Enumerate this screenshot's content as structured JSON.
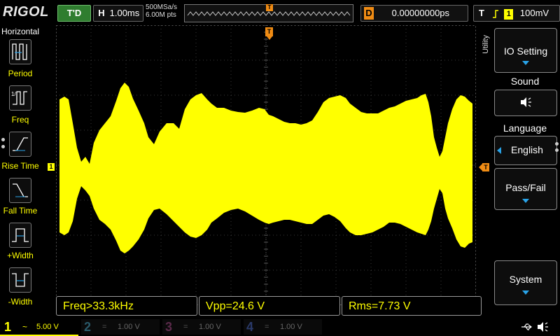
{
  "brand": "RIGOL",
  "top": {
    "trigger_status": "T'D",
    "horizontal_label": "H",
    "timebase": "1.00ms",
    "sample_rate": "500MSa/s",
    "memory_depth": "6.00M pts",
    "delay_label": "D",
    "delay_value": "0.00000000ps",
    "trigger_label": "T",
    "trigger_edge_icon": "rising-edge-icon",
    "trigger_channel": "1",
    "trigger_level": "100mV",
    "marker_label": "T"
  },
  "left_menu": {
    "title": "Horizontal",
    "items": [
      {
        "label": "Period",
        "icon": "period-icon"
      },
      {
        "label": "Freq",
        "icon": "frequency-icon"
      },
      {
        "label": "Rise Time",
        "icon": "rise-time-icon"
      },
      {
        "label": "Fall Time",
        "icon": "fall-time-icon"
      },
      {
        "label": "+Width",
        "icon": "positive-width-icon"
      },
      {
        "label": "-Width",
        "icon": "negative-width-icon"
      }
    ]
  },
  "right_menu": {
    "header": "Utility",
    "items": [
      {
        "label": "IO Setting"
      },
      {
        "label": "Sound",
        "value_icon": "speaker-icon"
      },
      {
        "label": "Language",
        "value": "English"
      },
      {
        "label": "Pass/Fail"
      },
      {
        "label": "System"
      }
    ]
  },
  "measurements": [
    "Freq>33.3kHz",
    "Vpp=24.6 V",
    "Rms=7.73 V"
  ],
  "channels": [
    {
      "num": "1",
      "scale": "5.00 V",
      "coupling": "~",
      "color": "#ffff00",
      "active": true
    },
    {
      "num": "2",
      "scale": "1.00 V",
      "coupling": "=",
      "color": "#2aa9d9",
      "active": false
    },
    {
      "num": "3",
      "scale": "1.00 V",
      "coupling": "=",
      "color": "#d14fa0",
      "active": false
    },
    {
      "num": "4",
      "scale": "1.00 V",
      "coupling": "=",
      "color": "#2a6bd9",
      "active": false
    }
  ],
  "channel_marker": "1",
  "colors": {
    "ch1": "#ffff00",
    "accent": "#29a3e8",
    "trigger": "#f08c14",
    "status_green": "#2f7d2f"
  }
}
